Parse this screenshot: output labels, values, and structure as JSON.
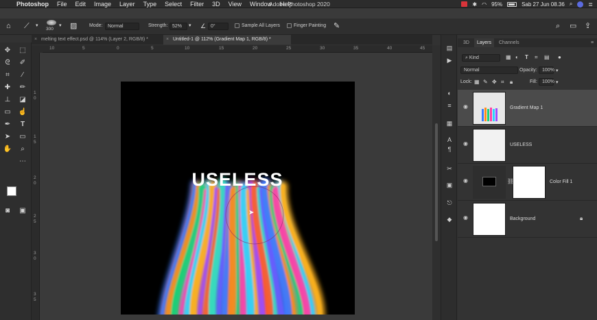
{
  "menubar": {
    "app": "Photoshop",
    "menus": [
      "File",
      "Edit",
      "Image",
      "Layer",
      "Type",
      "Select",
      "Filter",
      "3D",
      "View",
      "Window",
      "Help"
    ],
    "window_title": "Adobe Photoshop 2020",
    "battery": "95%",
    "datetime": "Sab 27 Jun  08.36"
  },
  "options_bar": {
    "brush_size": "300",
    "mode_label": "Mode:",
    "mode_value": "Normal",
    "strength_label": "Strength:",
    "strength_value": "52%",
    "angle_value": "0°",
    "sample_all_layers": "Sample All Layers",
    "finger_painting": "Finger Painting"
  },
  "tabs": [
    {
      "label": "melting text effect.psd @ 114% (Layer 2, RGB/8) *",
      "active": false
    },
    {
      "label": "Untitled-1 @ 112% (Gradient Map 1, RGB/8) *",
      "active": true
    }
  ],
  "ruler": {
    "h_ticks": [
      "10",
      "5",
      "0",
      "5",
      "10",
      "15",
      "20",
      "25",
      "30",
      "35",
      "40",
      "45"
    ],
    "v_ticks": [
      "1",
      "0",
      "1",
      "5",
      "2",
      "0",
      "2",
      "5",
      "3",
      "0",
      "3",
      "5"
    ]
  },
  "canvas": {
    "text": "USELESS",
    "drip_colors": [
      "#3a7bff",
      "#ff8a1a",
      "#19d37a",
      "#ff3fa8",
      "#2ad4ff",
      "#ffb31f",
      "#9b4dff",
      "#ff5a2a",
      "#36e0c0",
      "#6a5bff"
    ]
  },
  "panel": {
    "tabs": [
      "3D",
      "Layers",
      "Channels"
    ],
    "kind_label": "Kind",
    "blend_mode": "Normal",
    "opacity_label": "Opacity:",
    "opacity_value": "100%",
    "lock_label": "Lock:",
    "fill_label": "Fill:",
    "fill_value": "100%",
    "layers": [
      {
        "name": "Gradient Map 1",
        "active": true
      },
      {
        "name": "USELESS",
        "active": false
      },
      {
        "name": "Color Fill 1",
        "active": false
      },
      {
        "name": "Background",
        "active": false
      }
    ]
  }
}
